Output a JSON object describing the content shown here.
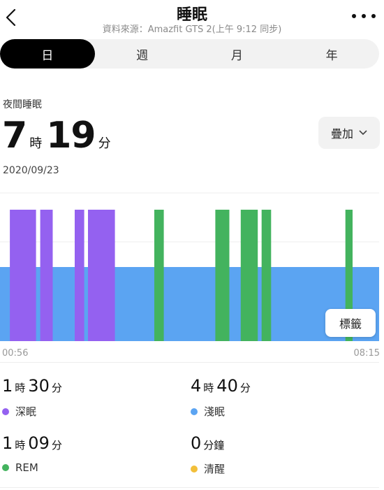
{
  "header": {
    "title": "睡眠",
    "subtitle": "資料來源：Amazfit GTS 2(上午 9:12 同步)"
  },
  "tabs": [
    {
      "label": "日",
      "active": true
    },
    {
      "label": "週",
      "active": false
    },
    {
      "label": "月",
      "active": false
    },
    {
      "label": "年",
      "active": false
    }
  ],
  "summary": {
    "section_label": "夜間睡眠",
    "hours": "7",
    "hours_unit": "時",
    "minutes": "19",
    "minutes_unit": "分",
    "date": "2020/09/23",
    "overlay_label": "疊加"
  },
  "chart": {
    "start_time": "00:56",
    "end_time": "08:15",
    "marker_label": "標籤"
  },
  "chart_data": {
    "type": "bar",
    "x_range": [
      "00:56",
      "08:15"
    ],
    "levels": [
      "淺眠",
      "深眠",
      "REM"
    ],
    "colors": {
      "淺眠": "#5ba4f2",
      "深眠": "#9461f0",
      "REM": "#43b35e"
    },
    "segments": [
      {
        "stage": "淺眠",
        "start": 0.0,
        "end": 1.0
      },
      {
        "stage": "深眠",
        "start": 0.026,
        "end": 0.095
      },
      {
        "stage": "深眠",
        "start": 0.106,
        "end": 0.139
      },
      {
        "stage": "深眠",
        "start": 0.197,
        "end": 0.222
      },
      {
        "stage": "深眠",
        "start": 0.232,
        "end": 0.303
      },
      {
        "stage": "REM",
        "start": 0.407,
        "end": 0.432
      },
      {
        "stage": "REM",
        "start": 0.568,
        "end": 0.605
      },
      {
        "stage": "REM",
        "start": 0.635,
        "end": 0.68
      },
      {
        "stage": "REM",
        "start": 0.69,
        "end": 0.715
      },
      {
        "stage": "REM",
        "start": 0.911,
        "end": 0.93
      }
    ]
  },
  "stats": [
    {
      "h": "1",
      "h_unit": "時",
      "m": "30",
      "m_unit": "分",
      "label": "深眠",
      "color": "#9461f0"
    },
    {
      "h": "4",
      "h_unit": "時",
      "m": "40",
      "m_unit": "分",
      "label": "淺眠",
      "color": "#5ba4f2"
    },
    {
      "h": "1",
      "h_unit": "時",
      "m": "09",
      "m_unit": "分",
      "label": "REM",
      "color": "#43b35e"
    },
    {
      "h": "",
      "h_unit": "",
      "m": "0",
      "m_unit": "分鐘",
      "label": "清醒",
      "color": "#f2bf3a"
    }
  ]
}
